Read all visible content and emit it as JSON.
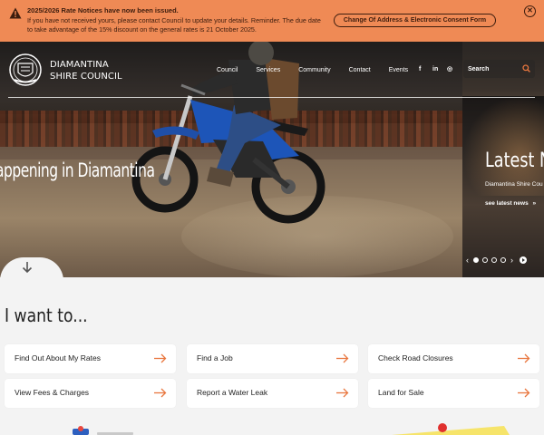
{
  "alert": {
    "title": "2025/2026 Rate Notices have now been issued.",
    "text": "If you have not received yours, please contact Council to update your details. Reminder. The due date to take advantage of the 15% discount on the general rates is 21 October 2025.",
    "button_label": "Change Of Address & Electronic Consent Form",
    "close_symbol": "✕",
    "warning_icon": "warning-icon",
    "background_color": "#ef8a55"
  },
  "header": {
    "logo_line1": "DIAMANTINA",
    "logo_line2": "SHIRE COUNCIL",
    "nav": [
      "Council",
      "Services",
      "Community",
      "Contact",
      "Events"
    ],
    "social": {
      "facebook": "f",
      "linkedin": "in",
      "instagram": "◎"
    },
    "search_placeholder": "Search"
  },
  "hero": {
    "main_text": "appening in Diamantina",
    "side_title": "Latest N",
    "side_subtitle": "Diamantina Shire Cou",
    "side_link": "see latest news",
    "side_link_arrow": "»",
    "carousel": {
      "prev": "‹",
      "next": "›",
      "dots": 4,
      "active_dot": 0
    }
  },
  "i_want_to": {
    "heading": "I want to...",
    "links": [
      {
        "label": "Find Out About My Rates"
      },
      {
        "label": "Find a Job"
      },
      {
        "label": "Check Road Closures"
      },
      {
        "label": "View Fees & Charges"
      },
      {
        "label": "Report a Water Leak"
      },
      {
        "label": "Land for Sale"
      }
    ],
    "arrow_color": "#e8763e"
  }
}
